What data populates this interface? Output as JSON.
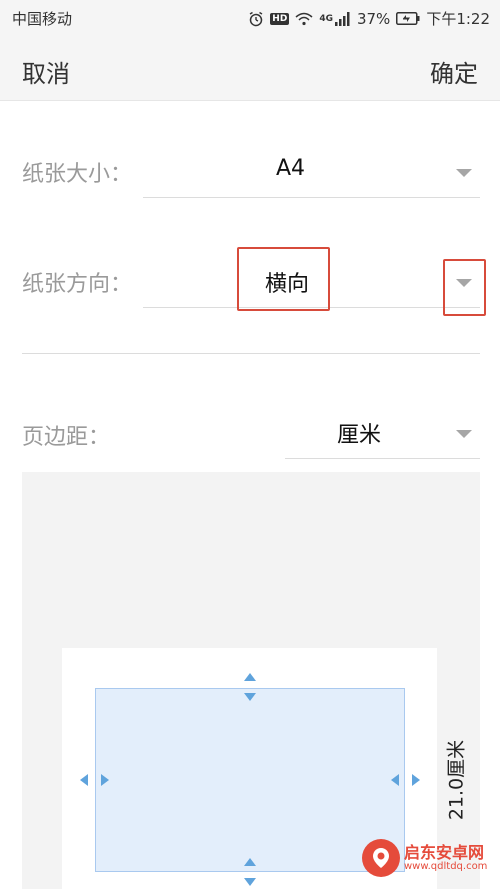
{
  "status_bar": {
    "carrier": "中国移动",
    "hd": "HD",
    "network": "4G",
    "battery": "37%",
    "time": "下午1:22"
  },
  "app_bar": {
    "cancel_label": "取消",
    "confirm_label": "确定"
  },
  "paper_size": {
    "label": "纸张大小：",
    "value": "A4"
  },
  "paper_orientation": {
    "label": "纸张方向：",
    "value": "横向"
  },
  "margins": {
    "label": "页边距：",
    "unit": "厘米"
  },
  "preview": {
    "height_label": "21.0厘米"
  },
  "watermark": {
    "title": "启东安卓网",
    "url": "www.qdltdq.com"
  },
  "colors": {
    "highlight": "#d74b3b",
    "margin_fill": "#e3eefb",
    "arrow": "#5fa3dc"
  },
  "icons": {
    "alarm": "alarm-icon",
    "wifi": "wifi-icon",
    "signal": "signal-icon",
    "battery": "battery-icon",
    "dropdown": "chevron-down-icon"
  }
}
